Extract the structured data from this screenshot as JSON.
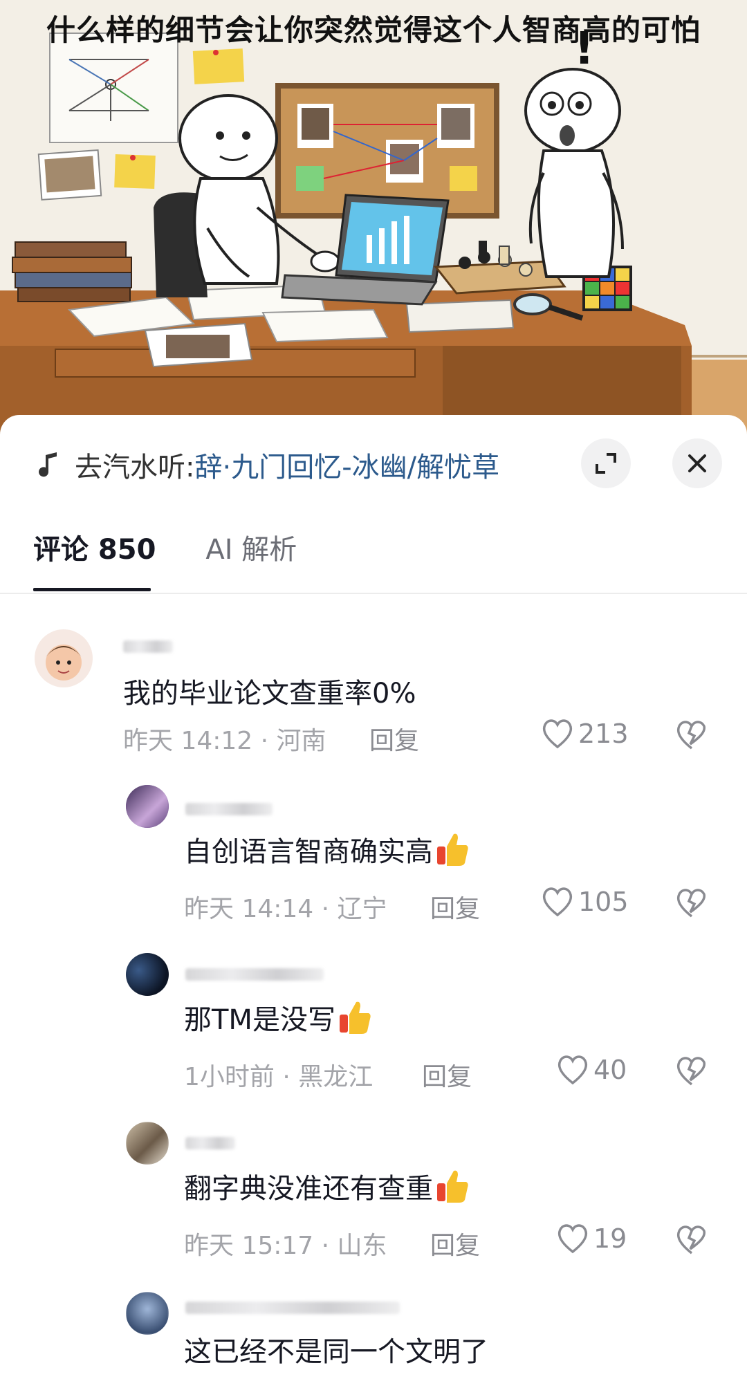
{
  "hero": {
    "title": "什么样的细节会让你突然觉得这个人智商高的可怕"
  },
  "music": {
    "prefix": "去汽水听: ",
    "title": "辞·九门回忆-冰幽/解忧草",
    "icon": "music-note-icon"
  },
  "tabs": [
    {
      "label": "评论 850",
      "active": true
    },
    {
      "label": "AI 解析",
      "active": false
    }
  ],
  "comments": [
    {
      "text": "我的毕业论文查重率0%",
      "time": "昨天 14:12",
      "location": "河南",
      "reply": "回复",
      "likes": "213",
      "emoji": false
    },
    {
      "text": "自创语言智商确实高",
      "time": "昨天 14:14",
      "location": "辽宁",
      "reply": "回复",
      "likes": "105",
      "emoji": true
    },
    {
      "text": "那TM是没写",
      "time": "1小时前",
      "location": "黑龙江",
      "reply": "回复",
      "likes": "40",
      "emoji": true
    },
    {
      "text": "翻字典没准还有查重",
      "time": "昨天 15:17",
      "location": "山东",
      "reply": "回复",
      "likes": "19",
      "emoji": true
    },
    {
      "text": "这已经不是同一个文明了",
      "emoji": false
    }
  ],
  "meta_sep": " · ",
  "colors": {
    "link": "#2c5a8c",
    "meta": "#a3a4a9",
    "text": "#161823"
  }
}
